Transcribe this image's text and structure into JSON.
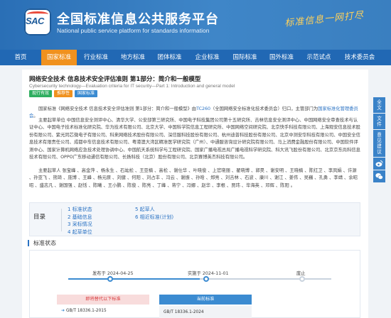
{
  "header": {
    "logo_text": "SAC",
    "title": "全国标准信息公共服务平台",
    "subtitle": "National public service platform  for standards information",
    "slogan": "标准信息一网打尽"
  },
  "nav": {
    "items": [
      {
        "label": "首页",
        "active": false
      },
      {
        "label": "国家标准",
        "active": true
      },
      {
        "label": "行业标准",
        "active": false
      },
      {
        "label": "地方标准",
        "active": false
      },
      {
        "label": "团体标准",
        "active": false
      },
      {
        "label": "企业标准",
        "active": false
      },
      {
        "label": "国际标准",
        "active": false
      },
      {
        "label": "国外标准",
        "active": false
      },
      {
        "label": "示范试点",
        "active": false
      },
      {
        "label": "技术委员会",
        "active": false
      }
    ]
  },
  "standard": {
    "title": "网络安全技术 信息技术安全评估准则 第1部分：简介和一般模型",
    "title_en": "Cybersecurity technology—Evaluation criteria for IT security—Part 1: Introduction and general model",
    "tags": [
      "现行有效",
      "推荐性",
      "国家标准"
    ],
    "para1_a": "国家标准《网络安全技术 信息技术安全评估准则 第1部分：简介和一般模型》由",
    "para1_link1": "TC260",
    "para1_b": "（全国网络安全标准化技术委员会）归口，主管部门为",
    "para1_link2": "国家标准化管理委员会",
    "para1_c": "。",
    "para2": "主要起草单位 中国信息安全测评中心、清华大学、公安部第三研究所、中国电子科技集团公司第十五研究所、吉林信息安全测评中心、中国网络安全审查技术与认证中心、中国电子技术标准化研究院、华为技术有限公司、北京大学、中国科学院信息工程研究所、中国网络空间研究院、北京快手科技有限公司、上海观安信息技术股份有限公司、紫光同芯微电子有限公司、科来网络技术股份有限公司、深信服科技股份有限公司、杭州迪普科技股份有限公司、北京中测安华科技有限公司、中国安全信息技术有限责任公司、成都中车信息技术有限公司、粤港澳大湾区精准医学研究院（广州）、中通服咨询设计研究院有限公司、马上消费金融股份有限公司、中国软件评测中心、国家计算机网络应急技术处理协调中心、中国航天系统科学与工程研究院、国家广播电视总局广播电视科学研究院、科大讯飞股份有限公司、北京京东尚科信息技术有限公司、OPPO广东移动通信有限公司、长扬科技（北京）股份有限公司、北京赛博英杰科技有限公司。",
    "para3": "主要起草人 张宝峰 、高金萍 、杨永生 、石竑松 、王亚楠 、高松 、谢仕华 、叶晓俊 、上官晓丽 、翟晓博 、郭昊 、谢安明 、王晓楠 、陈红卫 、李凤娟 、许源 、孙亚飞 、熊琦 、庞博 、王峰 、杨元原 、刘健 、何阳 、刘占丰 、冯云 、谢振 、孙晗 、郑亮 、刘吉林 、石波 、康川 、谢江 、姜伟 、吴巍 、孔勇 、李靖 、余昭昭 、盛志凡 、谢国强 、赵恬 、陈曦 、王小鹏 、陈俊 、陈亮 、丁峰 、蒋宁 、冯娜 、赵华 、李根 、贾玮 、毕海英 、邓辉 、陈阳 。"
  },
  "toc": {
    "label": "目录",
    "col1": [
      "1 标准状态",
      "2 基础信息",
      "3 采标情况",
      "4 起草单位"
    ],
    "col2": [
      "5 起草人",
      "6 相近标准(计划)"
    ]
  },
  "status": {
    "title": "标准状态",
    "progress": 0.5,
    "milestones": [
      {
        "label": "发布于 2024-04-25",
        "done": true
      },
      {
        "label": "实施于 2024-11-01",
        "done": true
      },
      {
        "label": "废止",
        "done": false
      }
    ],
    "replaced_head": "即将替代以下标准",
    "replaced_item": "GB/T 18336.1-2015",
    "current_head": "当前标准",
    "current_item": "GB/T 18336.1-2024"
  },
  "sidebar": {
    "items": [
      "全文",
      "文件",
      "意见建议"
    ],
    "icons": [
      "weibo-icon",
      "wechat-icon"
    ]
  },
  "colors": {
    "header_blue": "#2a6fb6",
    "nav_blue": "#2168b4",
    "nav_active": "#f0911e",
    "link": "#2a72c3",
    "tag_green": "#2fae60",
    "tag_orange": "#f0911e",
    "tag_blue": "#3b8bd1"
  }
}
